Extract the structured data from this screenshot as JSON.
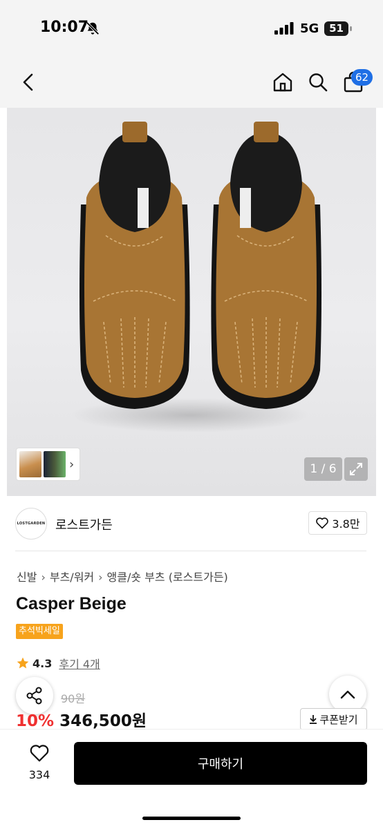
{
  "status_bar": {
    "time": "10:07",
    "network": "5G",
    "battery": "51"
  },
  "header": {
    "cart_count": "62"
  },
  "gallery": {
    "counter": "1 / 6"
  },
  "brand": {
    "logo_text": "LOSTGARDEN",
    "name": "로스트가든",
    "likes": "3.8만"
  },
  "breadcrumb": [
    "신발",
    "부츠/워커",
    "앵클/숏 부츠 (로스트가든)"
  ],
  "product": {
    "title": "Casper Beige",
    "badge": "추석빅세일",
    "rating": "4.3",
    "reviews": "후기 4개",
    "original_price": "90원",
    "discount": "10%",
    "price": "346,500원",
    "coupon_label": "쿠폰받기"
  },
  "bottom": {
    "wish_count": "334",
    "buy_label": "구매하기"
  },
  "colors": {
    "accent": "#1f6fe5",
    "sale": "#ef3030",
    "badge": "#f7a31c",
    "star": "#f7a31c"
  }
}
